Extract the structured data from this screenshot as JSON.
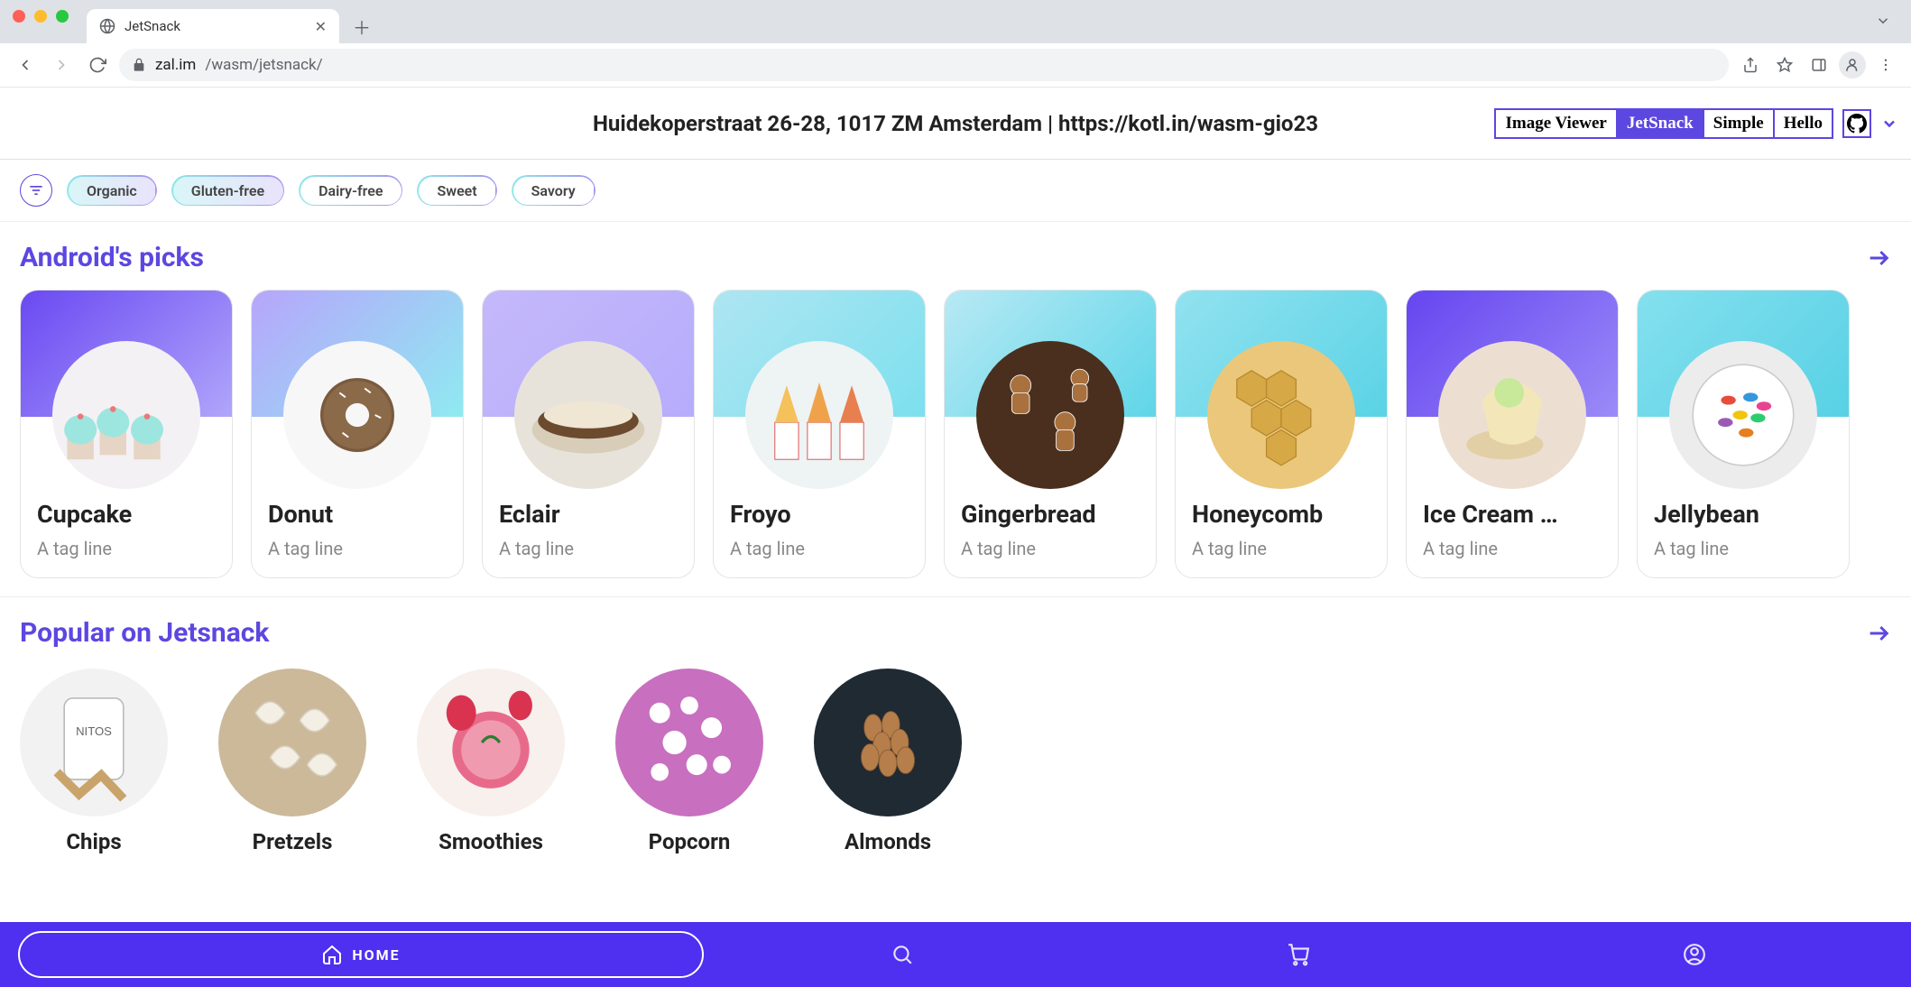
{
  "browser": {
    "tab_title": "JetSnack",
    "url_host": "zal.im",
    "url_path": "/wasm/jetsnack/"
  },
  "page_header": {
    "title": "Huidekoperstraat 26-28, 1017 ZM Amsterdam | https://kotl.in/wasm-gio23",
    "demo_tabs": [
      "Image Viewer",
      "JetSnack",
      "Simple",
      "Hello"
    ],
    "active_demo_tab": "JetSnack"
  },
  "filters": [
    "Organic",
    "Gluten-free",
    "Dairy-free",
    "Sweet",
    "Savory"
  ],
  "sections": {
    "picks": {
      "title": "Android's picks",
      "cards": [
        {
          "name": "Cupcake",
          "tagline": "A tag line"
        },
        {
          "name": "Donut",
          "tagline": "A tag line"
        },
        {
          "name": "Eclair",
          "tagline": "A tag line"
        },
        {
          "name": "Froyo",
          "tagline": "A tag line"
        },
        {
          "name": "Gingerbread",
          "tagline": "A tag line"
        },
        {
          "name": "Honeycomb",
          "tagline": "A tag line"
        },
        {
          "name": "Ice Cream …",
          "tagline": "A tag line"
        },
        {
          "name": "Jellybean",
          "tagline": "A tag line"
        }
      ]
    },
    "popular": {
      "title": "Popular on Jetsnack",
      "items": [
        {
          "name": "Chips"
        },
        {
          "name": "Pretzels"
        },
        {
          "name": "Smoothies"
        },
        {
          "name": "Popcorn"
        },
        {
          "name": "Almonds"
        }
      ]
    }
  },
  "bottom_nav": {
    "home_label": "HOME"
  }
}
